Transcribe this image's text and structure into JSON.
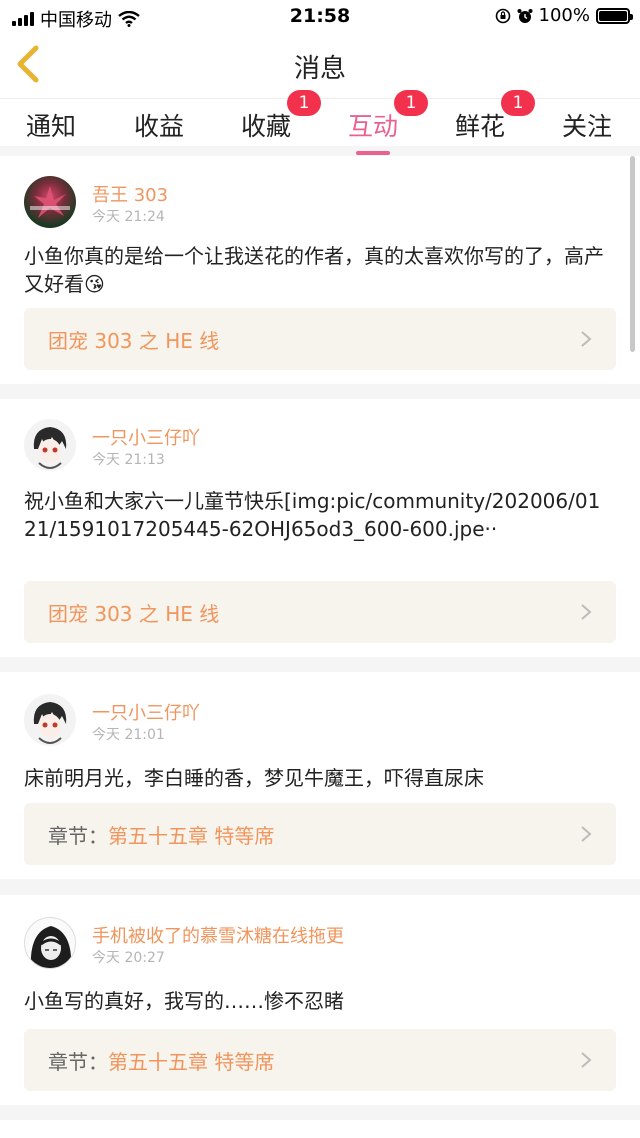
{
  "status_bar": {
    "carrier": "中国移动",
    "time": "21:58",
    "battery": "100%",
    "battery_level": 1.0
  },
  "nav": {
    "title": "消息",
    "back_icon": "chevron-left-icon"
  },
  "colors": {
    "accent_pink": "#e9618f",
    "accent_orange": "#f1955d",
    "badge_red": "#f2314d",
    "ref_bg": "#f6f4ec"
  },
  "tabs": [
    {
      "label": "通知",
      "badge": null
    },
    {
      "label": "收益",
      "badge": null
    },
    {
      "label": "收藏",
      "badge": "1"
    },
    {
      "label": "互动",
      "badge": "1",
      "active": true
    },
    {
      "label": "鲜花",
      "badge": "1"
    },
    {
      "label": "关注",
      "badge": null
    }
  ],
  "items": [
    {
      "user": "吾王 303",
      "time": "今天 21:24",
      "content": "小鱼你真的是给一个让我送花的作者，真的太喜欢你写的了，高产又好看😘",
      "ref_prefix": "",
      "ref": "团宠 303 之 HE 线"
    },
    {
      "user": "一只小三仔吖",
      "time": "今天 21:13",
      "content": "祝小鱼和大家六一儿童节快乐[img:pic/community/202006/0121/1591017205445-62OHJ65od3_600-600.jpe··",
      "ref_prefix": "",
      "ref": "团宠 303 之 HE 线"
    },
    {
      "user": "一只小三仔吖",
      "time": "今天 21:01",
      "content": "床前明月光，李白睡的香，梦见牛魔王，吓得直尿床",
      "ref_prefix": "章节：",
      "ref": "第五十五章  特等席"
    },
    {
      "user": "手机被收了的慕雪沐糖在线拖更",
      "time": "今天 20:27",
      "content": "小鱼写的真好，我写的……惨不忍睹",
      "ref_prefix": "章节：",
      "ref": "第五十五章  特等席"
    }
  ]
}
